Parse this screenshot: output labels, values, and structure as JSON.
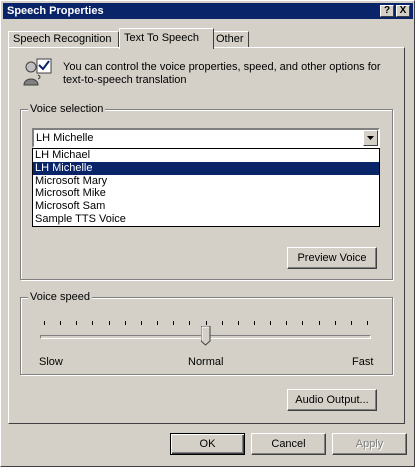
{
  "window": {
    "title": "Speech Properties",
    "help_glyph": "?",
    "close_glyph": "X"
  },
  "tabs": [
    {
      "label": "Speech Recognition",
      "active": false
    },
    {
      "label": "Text To Speech",
      "active": true
    },
    {
      "label": "Other",
      "active": false
    }
  ],
  "intro": {
    "text": "You can control the voice properties, speed, and other options for text-to-speech translation",
    "icon": "speech-user-icon"
  },
  "voice_selection": {
    "label": "Voice selection",
    "selected": "LH Michelle",
    "options": [
      "LH Michael",
      "LH Michelle",
      "Microsoft Mary",
      "Microsoft Mike",
      "Microsoft Sam",
      "Sample TTS Voice"
    ],
    "highlighted_index": 1,
    "preview_button": "Preview Voice"
  },
  "voice_speed": {
    "label": "Voice speed",
    "slow": "Slow",
    "normal": "Normal",
    "fast": "Fast",
    "position": 0.5
  },
  "audio_output_button": "Audio Output...",
  "footer": {
    "ok": "OK",
    "cancel": "Cancel",
    "apply": "Apply"
  },
  "colors": {
    "face": "#d4d0c8",
    "title_bar": "#0a246a",
    "selection": "#0a246a"
  }
}
